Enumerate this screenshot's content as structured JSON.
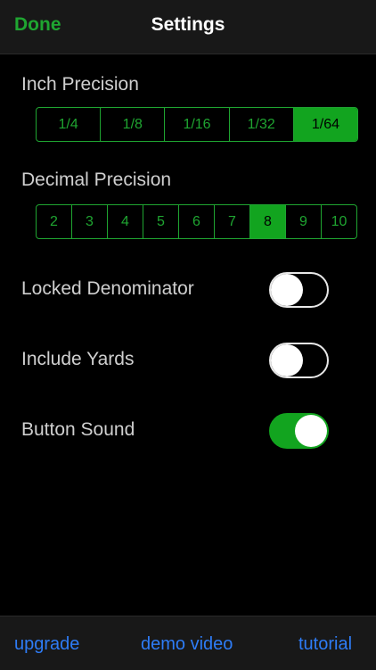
{
  "navbar": {
    "done_label": "Done",
    "title": "Settings"
  },
  "inch_precision": {
    "label": "Inch Precision",
    "options": [
      "1/4",
      "1/8",
      "1/16",
      "1/32",
      "1/64"
    ],
    "selected": "1/64"
  },
  "decimal_precision": {
    "label": "Decimal Precision",
    "options": [
      "2",
      "3",
      "4",
      "5",
      "6",
      "7",
      "8",
      "9",
      "10"
    ],
    "selected": "8"
  },
  "toggles": [
    {
      "label": "Locked Denominator",
      "on": false
    },
    {
      "label": "Include Yards",
      "on": false
    },
    {
      "label": "Button Sound",
      "on": true
    }
  ],
  "bottom_bar": {
    "upgrade_label": "upgrade",
    "demo_video_label": "demo video",
    "tutorial_label": "tutorial"
  },
  "colors": {
    "accent_green": "#12a41f",
    "link_blue": "#2e7cf6",
    "background": "#000000"
  }
}
